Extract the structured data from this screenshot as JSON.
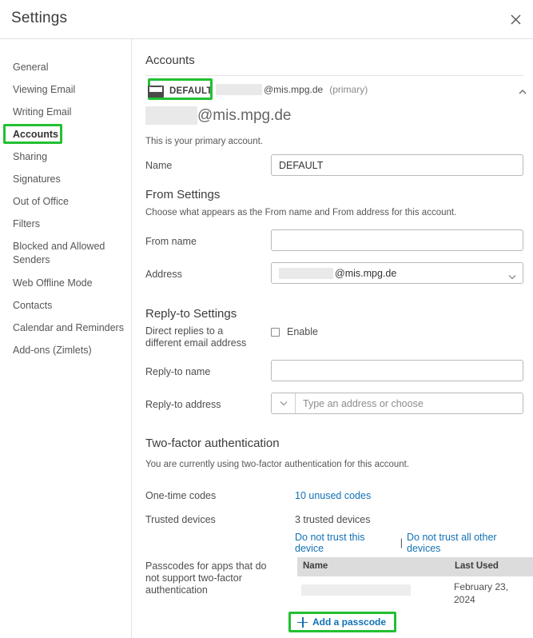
{
  "window": {
    "title": "Settings",
    "close_icon": "close-icon"
  },
  "sidebar": {
    "items": [
      {
        "label": "General",
        "active": false
      },
      {
        "label": "Viewing Email",
        "active": false
      },
      {
        "label": "Writing Email",
        "active": false
      },
      {
        "label": "Accounts",
        "active": true
      },
      {
        "label": "Sharing",
        "active": false
      },
      {
        "label": "Signatures",
        "active": false
      },
      {
        "label": "Out of Office",
        "active": false
      },
      {
        "label": "Filters",
        "active": false
      },
      {
        "label": "Blocked and Allowed Senders",
        "active": false
      },
      {
        "label": "Web Offline Mode",
        "active": false
      },
      {
        "label": "Contacts",
        "active": false
      },
      {
        "label": "Calendar and Reminders",
        "active": false
      },
      {
        "label": "Add-ons (Zimlets)",
        "active": false
      }
    ]
  },
  "main": {
    "page_title": "Accounts",
    "account": {
      "badge_label": "DEFAULT",
      "badge_icon": "envelope-icon",
      "email_domain": "@mis.mpg.de",
      "primary_tag": "(primary)",
      "collapse_icon": "chevron-up-icon",
      "big_domain": "@mis.mpg.de",
      "note": "This is your primary account."
    },
    "name_row": {
      "label": "Name",
      "value": "DEFAULT"
    },
    "from_settings": {
      "title": "From Settings",
      "description": "Choose what appears as the From name and From address for this account.",
      "from_name_label": "From name",
      "from_name_value": "",
      "address_label": "Address",
      "address_value": "@mis.mpg.de",
      "address_caret_icon": "chevron-down-icon"
    },
    "reply_to": {
      "title": "Reply-to Settings",
      "direct_label": "Direct replies to a different email address",
      "enable_label": "Enable",
      "enable_checked": false,
      "name_label": "Reply-to name",
      "name_value": "",
      "address_label": "Reply-to address",
      "address_placeholder": "Type an address or choose",
      "address_caret_icon": "chevron-down-icon"
    },
    "two_factor": {
      "title": "Two-factor authentication",
      "description": "You are currently using two-factor authentication for this account.",
      "onetime_label": "One-time codes",
      "onetime_link": "10 unused codes",
      "trusted_label": "Trusted devices",
      "trusted_value": "3 trusted devices",
      "distrust_this": "Do not trust this device",
      "distrust_sep": "|",
      "distrust_all": "Do not trust all other devices"
    },
    "passcodes": {
      "label": "Passcodes for apps that do not support two-factor authentication",
      "columns": [
        "Name",
        "Last Used"
      ],
      "rows": [
        {
          "name": "",
          "last_used": "February 23, 2024"
        }
      ],
      "add_label": "Add a passcode",
      "add_icon": "plus-icon"
    }
  },
  "colors": {
    "highlight": "#22c032",
    "link": "#1271b5",
    "text": "#4e4e4e",
    "table_header_bg": "#dcdcdc"
  }
}
